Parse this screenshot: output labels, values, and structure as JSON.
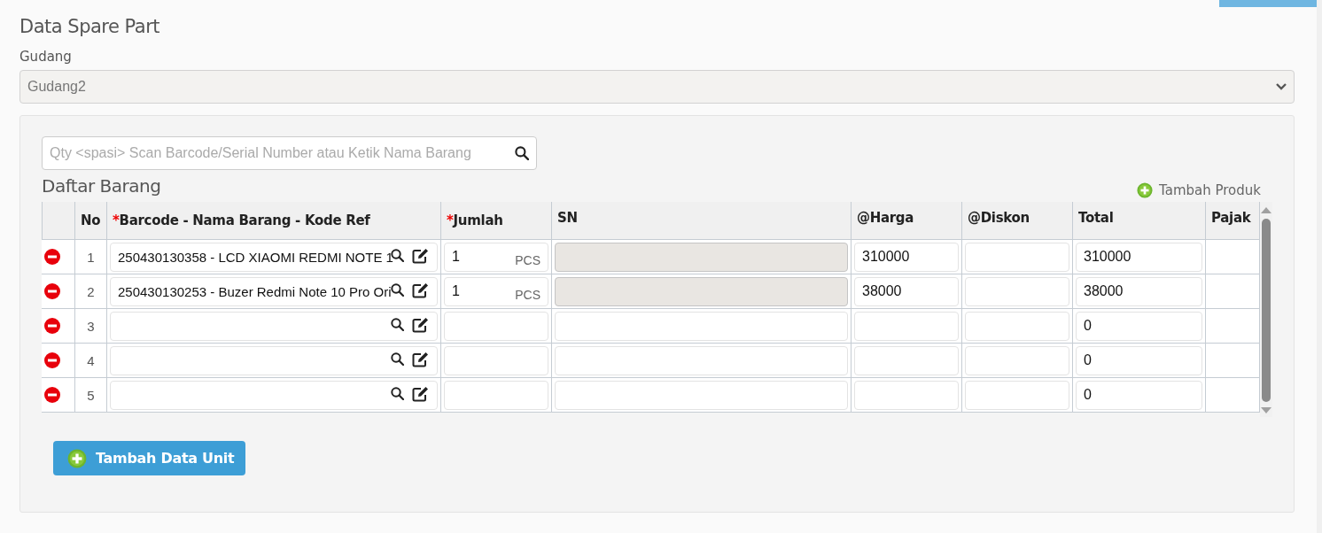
{
  "title": "Data Spare Part",
  "warehouse": {
    "label": "Gudang",
    "value": "Gudang2",
    "disabled": true
  },
  "search": {
    "placeholder": "Qty <spasi> Scan Barcode/Serial Number atau Ketik Nama Barang"
  },
  "list_title": "Daftar Barang",
  "add_product": "Tambah Produk",
  "table": {
    "columns": [
      {
        "label": "No"
      },
      {
        "label": "Barcode - Nama Barang - Kode Ref",
        "required_mark": "*"
      },
      {
        "label": "Jumlah",
        "required_mark": "*"
      },
      {
        "label": "SN"
      },
      {
        "label": "@Harga"
      },
      {
        "label": "@Diskon"
      },
      {
        "label": "Total"
      },
      {
        "label": "Pajak"
      }
    ],
    "rows": [
      {
        "no": "1",
        "item": "250430130358 - LCD XIAOMI REDMI NOTE 1",
        "qty": "1",
        "unit": "PCS",
        "sn_disabled": true,
        "price": "310000",
        "total": "310000"
      },
      {
        "no": "2",
        "item": "250430130253 - Buzer Redmi Note 10 Pro Ori",
        "qty": "1",
        "unit": "PCS",
        "sn_disabled": true,
        "price": "38000",
        "total": "38000"
      },
      {
        "no": "3",
        "sn_disabled": false,
        "total": "0"
      },
      {
        "no": "4",
        "sn_disabled": false,
        "total": "0"
      },
      {
        "no": "5",
        "sn_disabled": false,
        "total": "0"
      }
    ]
  },
  "add_unit_button": "Tambah Data Unit"
}
